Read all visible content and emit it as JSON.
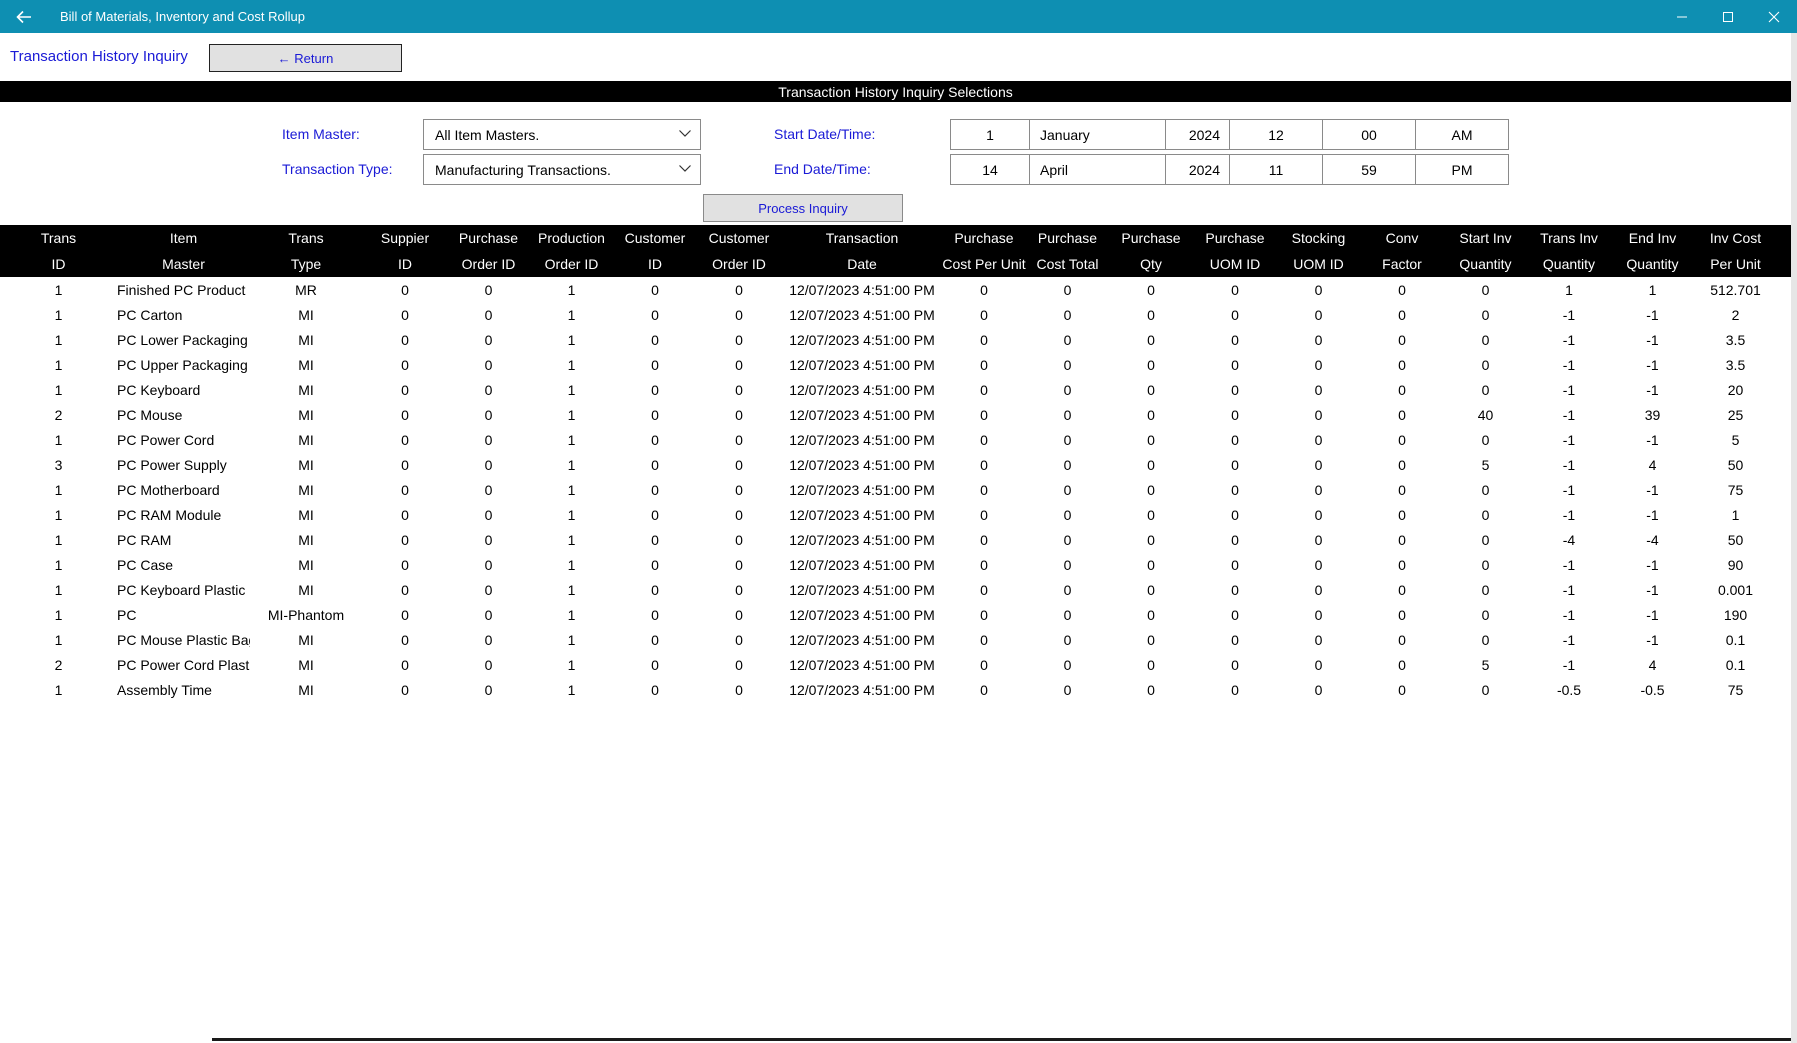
{
  "window": {
    "title": "Bill of Materials, Inventory and Cost Rollup",
    "back_icon": "arrow-left",
    "minimize_icon": "minimize",
    "maximize_icon": "maximize",
    "close_icon": "close"
  },
  "page": {
    "title": "Transaction History Inquiry",
    "return_label": "← Return",
    "band_title": "Transaction History Inquiry Selections"
  },
  "selections": {
    "item_master_label": "Item Master:",
    "item_master_value": "All Item Masters.",
    "trans_type_label": "Transaction Type:",
    "trans_type_value": "Manufacturing Transactions.",
    "start_label": "Start Date/Time:",
    "start": {
      "day": "1",
      "month": "January",
      "year": "2024",
      "hour": "12",
      "minute": "00",
      "ampm": "AM"
    },
    "end_label": "End Date/Time:",
    "end": {
      "day": "14",
      "month": "April",
      "year": "2024",
      "hour": "11",
      "minute": "59",
      "ampm": "PM"
    },
    "process_label": "Process Inquiry"
  },
  "table": {
    "headers": [
      [
        "Trans",
        "ID"
      ],
      [
        "Item",
        "Master"
      ],
      [
        "Trans",
        "Type"
      ],
      [
        "Suppier",
        "ID"
      ],
      [
        "Purchase",
        "Order ID"
      ],
      [
        "Production",
        "Order ID"
      ],
      [
        "Customer",
        "ID"
      ],
      [
        "Customer",
        "Order ID"
      ],
      [
        "Transaction",
        "Date"
      ],
      [
        "Purchase",
        "Cost Per Unit"
      ],
      [
        "Purchase",
        "Cost Total"
      ],
      [
        "Purchase",
        "Qty"
      ],
      [
        "Purchase",
        "UOM ID"
      ],
      [
        "Stocking",
        "UOM ID"
      ],
      [
        "Conv",
        "Factor"
      ],
      [
        "Start Inv",
        "Quantity"
      ],
      [
        "Trans Inv",
        "Quantity"
      ],
      [
        "End Inv",
        "Quantity"
      ],
      [
        "Inv Cost",
        "Per Unit"
      ]
    ],
    "rows": [
      [
        "1",
        "Finished PC Product",
        "MR",
        "0",
        "0",
        "1",
        "0",
        "0",
        "12/07/2023 4:51:00 PM",
        "0",
        "0",
        "0",
        "0",
        "0",
        "0",
        "0",
        "1",
        "1",
        "512.701"
      ],
      [
        "1",
        "PC Carton",
        "MI",
        "0",
        "0",
        "1",
        "0",
        "0",
        "12/07/2023 4:51:00 PM",
        "0",
        "0",
        "0",
        "0",
        "0",
        "0",
        "0",
        "-1",
        "-1",
        "2"
      ],
      [
        "1",
        "PC Lower Packaging",
        "MI",
        "0",
        "0",
        "1",
        "0",
        "0",
        "12/07/2023 4:51:00 PM",
        "0",
        "0",
        "0",
        "0",
        "0",
        "0",
        "0",
        "-1",
        "-1",
        "3.5"
      ],
      [
        "1",
        "PC Upper Packaging",
        "MI",
        "0",
        "0",
        "1",
        "0",
        "0",
        "12/07/2023 4:51:00 PM",
        "0",
        "0",
        "0",
        "0",
        "0",
        "0",
        "0",
        "-1",
        "-1",
        "3.5"
      ],
      [
        "1",
        "PC Keyboard",
        "MI",
        "0",
        "0",
        "1",
        "0",
        "0",
        "12/07/2023 4:51:00 PM",
        "0",
        "0",
        "0",
        "0",
        "0",
        "0",
        "0",
        "-1",
        "-1",
        "20"
      ],
      [
        "2",
        "PC Mouse",
        "MI",
        "0",
        "0",
        "1",
        "0",
        "0",
        "12/07/2023 4:51:00 PM",
        "0",
        "0",
        "0",
        "0",
        "0",
        "0",
        "40",
        "-1",
        "39",
        "25"
      ],
      [
        "1",
        "PC Power Cord",
        "MI",
        "0",
        "0",
        "1",
        "0",
        "0",
        "12/07/2023 4:51:00 PM",
        "0",
        "0",
        "0",
        "0",
        "0",
        "0",
        "0",
        "-1",
        "-1",
        "5"
      ],
      [
        "3",
        "PC Power Supply",
        "MI",
        "0",
        "0",
        "1",
        "0",
        "0",
        "12/07/2023 4:51:00 PM",
        "0",
        "0",
        "0",
        "0",
        "0",
        "0",
        "5",
        "-1",
        "4",
        "50"
      ],
      [
        "1",
        "PC Motherboard",
        "MI",
        "0",
        "0",
        "1",
        "0",
        "0",
        "12/07/2023 4:51:00 PM",
        "0",
        "0",
        "0",
        "0",
        "0",
        "0",
        "0",
        "-1",
        "-1",
        "75"
      ],
      [
        "1",
        "PC RAM Module",
        "MI",
        "0",
        "0",
        "1",
        "0",
        "0",
        "12/07/2023 4:51:00 PM",
        "0",
        "0",
        "0",
        "0",
        "0",
        "0",
        "0",
        "-1",
        "-1",
        "1"
      ],
      [
        "1",
        "PC RAM",
        "MI",
        "0",
        "0",
        "1",
        "0",
        "0",
        "12/07/2023 4:51:00 PM",
        "0",
        "0",
        "0",
        "0",
        "0",
        "0",
        "0",
        "-4",
        "-4",
        "50"
      ],
      [
        "1",
        "PC Case",
        "MI",
        "0",
        "0",
        "1",
        "0",
        "0",
        "12/07/2023 4:51:00 PM",
        "0",
        "0",
        "0",
        "0",
        "0",
        "0",
        "0",
        "-1",
        "-1",
        "90"
      ],
      [
        "1",
        "PC Keyboard Plastic Bag",
        "MI",
        "0",
        "0",
        "1",
        "0",
        "0",
        "12/07/2023 4:51:00 PM",
        "0",
        "0",
        "0",
        "0",
        "0",
        "0",
        "0",
        "-1",
        "-1",
        "0.001"
      ],
      [
        "1",
        "PC",
        "MI-Phantom",
        "0",
        "0",
        "1",
        "0",
        "0",
        "12/07/2023 4:51:00 PM",
        "0",
        "0",
        "0",
        "0",
        "0",
        "0",
        "0",
        "-1",
        "-1",
        "190"
      ],
      [
        "1",
        "PC Mouse Plastic Bag",
        "MI",
        "0",
        "0",
        "1",
        "0",
        "0",
        "12/07/2023 4:51:00 PM",
        "0",
        "0",
        "0",
        "0",
        "0",
        "0",
        "0",
        "-1",
        "-1",
        "0.1"
      ],
      [
        "2",
        "PC Power Cord Plastic Bag",
        "MI",
        "0",
        "0",
        "1",
        "0",
        "0",
        "12/07/2023 4:51:00 PM",
        "0",
        "0",
        "0",
        "0",
        "0",
        "0",
        "5",
        "-1",
        "4",
        "0.1"
      ],
      [
        "1",
        "Assembly Time",
        "MI",
        "0",
        "0",
        "1",
        "0",
        "0",
        "12/07/2023 4:51:00 PM",
        "0",
        "0",
        "0",
        "0",
        "0",
        "0",
        "0",
        "-0.5",
        "-0.5",
        "75"
      ]
    ]
  },
  "colors": {
    "titlebar": "#0e8fb2",
    "label_blue": "#1a1ad6",
    "band": "#000000"
  }
}
